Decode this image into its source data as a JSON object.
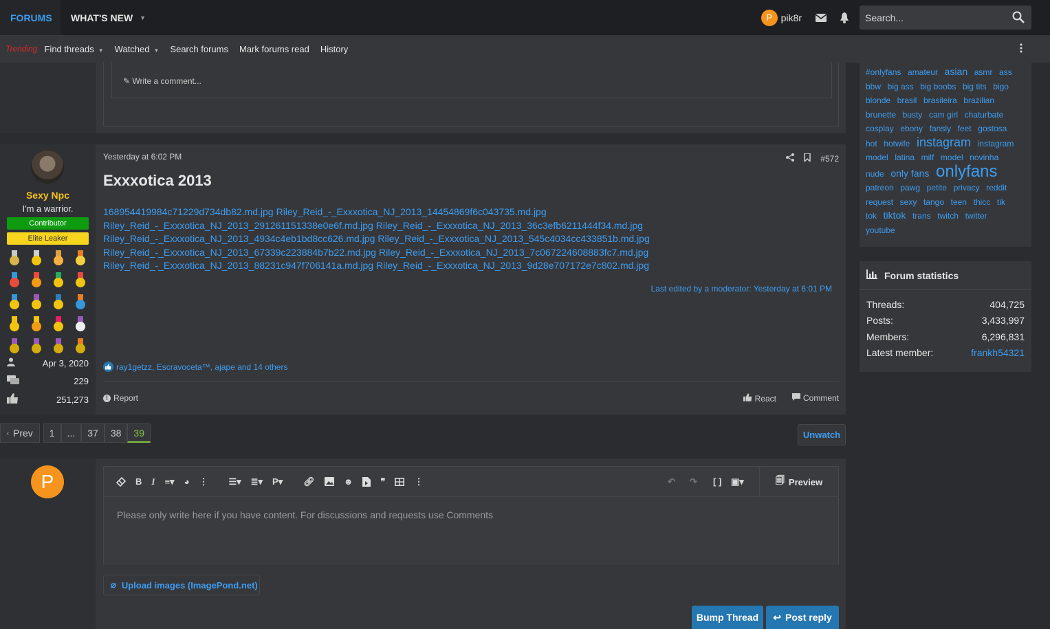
{
  "nav": {
    "forums": "FORUMS",
    "whats_new": "WHAT'S NEW",
    "username": "pik8r",
    "avatar_letter": "P",
    "search_placeholder": "Search..."
  },
  "subnav": {
    "trending": "Trending",
    "find_threads": "Find threads",
    "watched": "Watched",
    "search_forums": "Search forums",
    "mark_read": "Mark forums read",
    "history": "History"
  },
  "prev_post": {
    "comment_placeholder": "Write a comment..."
  },
  "post": {
    "user": {
      "name": "Sexy Npc",
      "title": "I'm a warrior.",
      "banner1": "Contributor",
      "banner2": "Elite Leaker",
      "joined": "Apr 3, 2020",
      "messages": "229",
      "reactions": "251,273"
    },
    "date": "Yesterday at 6:02 PM",
    "number": "#572",
    "title": "Exxxotica 2013",
    "images": [
      "168954419984c71229d734db82.md.jpg",
      "Riley_Reid_-_Exxxotica_NJ_2013_14454869f6c043735.md.jpg",
      "Riley_Reid_-_Exxxotica_NJ_2013_291261151338e0e6f.md.jpg",
      "Riley_Reid_-_Exxxotica_NJ_2013_36c3efb6211444f34.md.jpg",
      "Riley_Reid_-_Exxxotica_NJ_2013_4934c4eb1bd8cc626.md.jpg",
      "Riley_Reid_-_Exxxotica_NJ_2013_545c4034cc433851b.md.jpg",
      "Riley_Reid_-_Exxxotica_NJ_2013_67339c223884b7b22.md.jpg",
      "Riley_Reid_-_Exxxotica_NJ_2013_7c067224608883fc7.md.jpg",
      "Riley_Reid_-_Exxxotica_NJ_2013_88231c947f706141a.md.jpg",
      "Riley_Reid_-_Exxxotica_NJ_2013_9d28e707172e7c802.md.jpg"
    ],
    "edited": "Last edited by a moderator: Yesterday at 6:01 PM",
    "reactions_text": "ray1getzz, Escravoceta™, ajape and 14 others",
    "report": "Report",
    "react": "React",
    "comment": "Comment"
  },
  "pagination": {
    "prev": "Prev",
    "pages": [
      "1",
      "...",
      "37",
      "38",
      "39"
    ],
    "current": "39",
    "unwatch": "Unwatch"
  },
  "reply": {
    "avatar_letter": "P",
    "placeholder": "Please only write here if you have content. For discussions and requests use Comments",
    "preview": "Preview",
    "upload": "Upload images (ImagePond.net)",
    "bump": "Bump Thread",
    "post_reply": "Post reply"
  },
  "tags": [
    {
      "t": "#onlyfans",
      "s": 12
    },
    {
      "t": "amateur",
      "s": 12
    },
    {
      "t": "asian",
      "s": 14
    },
    {
      "t": "asmr",
      "s": 12
    },
    {
      "t": "ass",
      "s": 12
    },
    {
      "t": "bbw",
      "s": 12
    },
    {
      "t": "big ass",
      "s": 12
    },
    {
      "t": "big boobs",
      "s": 12
    },
    {
      "t": "big tits",
      "s": 12
    },
    {
      "t": "bigo",
      "s": 12
    },
    {
      "t": "blonde",
      "s": 12
    },
    {
      "t": "brasil",
      "s": 12
    },
    {
      "t": "brasileira",
      "s": 12
    },
    {
      "t": "brazilian",
      "s": 12
    },
    {
      "t": "brunette",
      "s": 12
    },
    {
      "t": "busty",
      "s": 12
    },
    {
      "t": "cam girl",
      "s": 12
    },
    {
      "t": "chaturbate",
      "s": 12
    },
    {
      "t": "cosplay",
      "s": 12
    },
    {
      "t": "ebony",
      "s": 12
    },
    {
      "t": "fansly",
      "s": 12
    },
    {
      "t": "feet",
      "s": 12
    },
    {
      "t": "gostosa",
      "s": 12
    },
    {
      "t": "hot",
      "s": 12
    },
    {
      "t": "hotwife",
      "s": 12
    },
    {
      "t": "instagram",
      "s": 18
    },
    {
      "t": "instagram",
      "s": 12
    },
    {
      "t": "model",
      "s": 12
    },
    {
      "t": "latina",
      "s": 12
    },
    {
      "t": "milf",
      "s": 12
    },
    {
      "t": "model",
      "s": 12
    },
    {
      "t": "novinha",
      "s": 12
    },
    {
      "t": "nude",
      "s": 12
    },
    {
      "t": "only fans",
      "s": 14
    },
    {
      "t": "onlyfans",
      "s": 24
    },
    {
      "t": "patreon",
      "s": 12
    },
    {
      "t": "pawg",
      "s": 12
    },
    {
      "t": "petite",
      "s": 12
    },
    {
      "t": "privacy",
      "s": 12
    },
    {
      "t": "reddit",
      "s": 12
    },
    {
      "t": "request",
      "s": 12
    },
    {
      "t": "sexy",
      "s": 12
    },
    {
      "t": "tango",
      "s": 12
    },
    {
      "t": "teen",
      "s": 12
    },
    {
      "t": "thicc",
      "s": 12
    },
    {
      "t": "tik",
      "s": 12
    },
    {
      "t": "tok",
      "s": 12
    },
    {
      "t": "tiktok",
      "s": 14
    },
    {
      "t": "trans",
      "s": 12
    },
    {
      "t": "twitch",
      "s": 12
    },
    {
      "t": "twitter",
      "s": 12
    },
    {
      "t": "youtube",
      "s": 12
    }
  ],
  "stats": {
    "title": "Forum statistics",
    "threads_label": "Threads:",
    "threads": "404,725",
    "posts_label": "Posts:",
    "posts": "3,433,997",
    "members_label": "Members:",
    "members": "6,296,831",
    "latest_label": "Latest member:",
    "latest": "frankh54321"
  },
  "colors": {
    "accent": "#3d9df0",
    "button": "#2577b1",
    "username": "#f7c21d",
    "contributor": "#0f9b0f",
    "elite": "#f7d41d",
    "avatar": "#f7941d",
    "current_page": "#81c341"
  }
}
